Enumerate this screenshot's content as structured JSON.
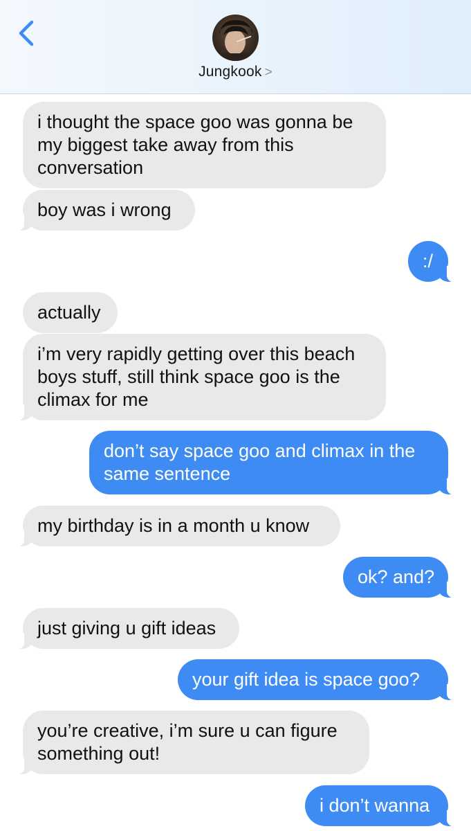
{
  "header": {
    "contact_name": "Jungkook",
    "chevron": ">"
  },
  "colors": {
    "accent": "#3e8cf3",
    "received_bubble": "#e9e9eb"
  },
  "messages": [
    {
      "from": "them",
      "lines": [
        "i thought the space goo was gonna be",
        "my biggest take away from this",
        "conversation"
      ]
    },
    {
      "from": "them",
      "lines": [
        "boy was i wrong"
      ]
    },
    {
      "from": "me",
      "lines": [
        ":/"
      ]
    },
    {
      "from": "them",
      "lines": [
        "actually"
      ]
    },
    {
      "from": "them",
      "lines": [
        "i’m very rapidly getting over this beach",
        "boys stuff, still think space goo is the",
        "climax for me"
      ]
    },
    {
      "from": "me",
      "lines": [
        "don’t say space goo and climax in the",
        "same sentence"
      ]
    },
    {
      "from": "them",
      "lines": [
        "my birthday is in a month u know"
      ]
    },
    {
      "from": "me",
      "lines": [
        "ok? and?"
      ]
    },
    {
      "from": "them",
      "lines": [
        "just giving u gift ideas"
      ]
    },
    {
      "from": "me",
      "lines": [
        "your gift idea is space goo?"
      ]
    },
    {
      "from": "them",
      "lines": [
        "you’re creative, i’m sure u can figure",
        "something out!"
      ]
    },
    {
      "from": "me",
      "lines": [
        "i don’t wanna"
      ]
    }
  ]
}
